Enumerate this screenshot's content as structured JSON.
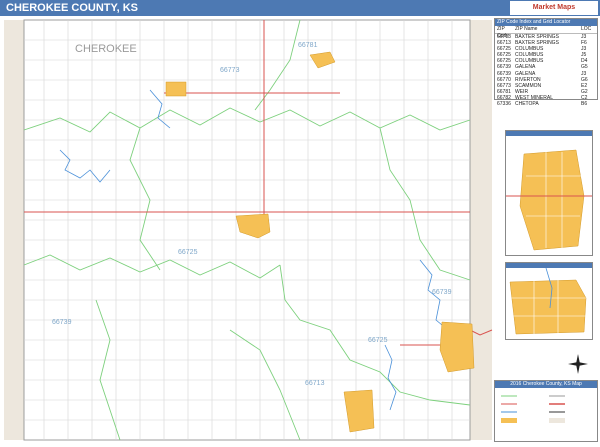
{
  "title": "CHEROKEE COUNTY, KS",
  "logo_text": "Market Maps",
  "county_label": "CHEROKEE",
  "zip_labels": [
    "66781",
    "66773",
    "66725",
    "66739",
    "66739",
    "66713",
    "66725"
  ],
  "legend": {
    "header": "ZIP Code Index and Grid Locator",
    "columns": [
      "ZIP Code",
      "ZIP Name",
      "LOC"
    ],
    "rows": [
      [
        "66713",
        "BAXTER SPRINGS",
        "J3"
      ],
      [
        "66713",
        "BAXTER SPRINGS",
        "F6"
      ],
      [
        "66725",
        "COLUMBUS",
        "J3"
      ],
      [
        "66725",
        "COLUMBUS",
        "J5"
      ],
      [
        "66725",
        "COLUMBUS",
        "D4"
      ],
      [
        "66739",
        "GALENA",
        "G5"
      ],
      [
        "66739",
        "GALENA",
        "J3"
      ],
      [
        "66770",
        "RIVERTON",
        "G6"
      ],
      [
        "66773",
        "SCAMMON",
        "E2"
      ],
      [
        "66781",
        "WEIR",
        "G2"
      ],
      [
        "66782",
        "WEST MINERAL",
        "C2"
      ],
      [
        "67336",
        "CHETOPA",
        "B6"
      ]
    ]
  },
  "key_title": "2016 Cherokee County, KS Map",
  "colors": {
    "title_bar": "#4d79b3",
    "urban": "#f5c055",
    "zip_boundary": "#7dd07d",
    "highway": "#d9534f",
    "water": "#4a90d9",
    "border": "#c8bfae"
  }
}
